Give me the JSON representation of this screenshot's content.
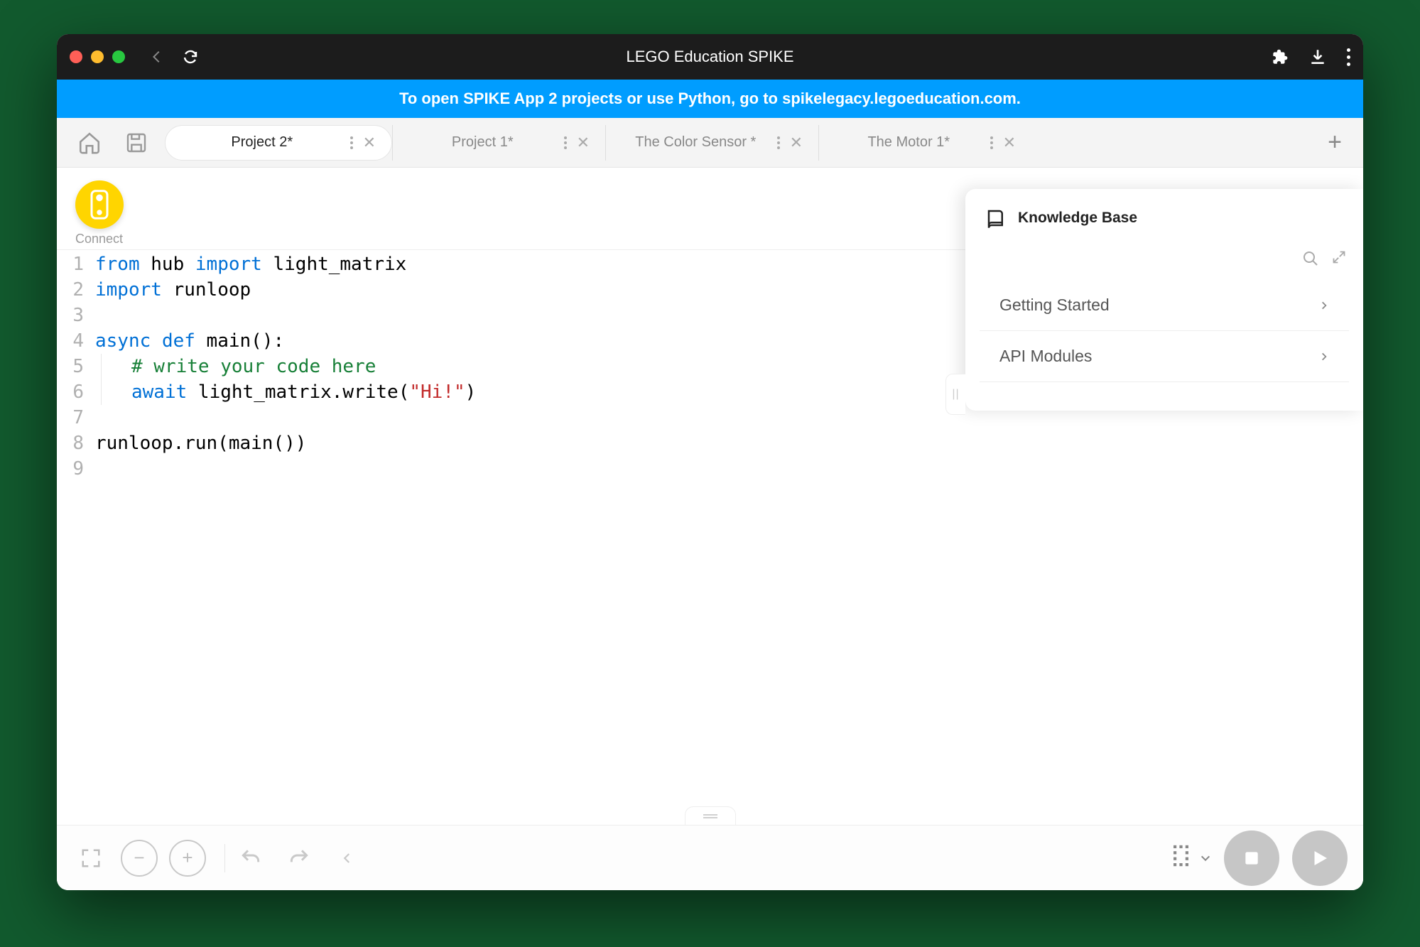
{
  "titlebar": {
    "title": "LEGO Education SPIKE"
  },
  "banner": {
    "text": "To open SPIKE App 2 projects or use Python, go to spikelegacy.legoeducation.com."
  },
  "tabs": [
    {
      "label": "Project 2*",
      "active": true
    },
    {
      "label": "Project 1*",
      "active": false
    },
    {
      "label": "The Color Sensor *",
      "active": false
    },
    {
      "label": "The Motor 1*",
      "active": false
    }
  ],
  "connect": {
    "label": "Connect"
  },
  "code": {
    "lines": [
      {
        "n": "1",
        "html": "<span class='kw'>from</span> hub <span class='kw'>import</span> light_matrix"
      },
      {
        "n": "2",
        "html": "<span class='kw'>import</span> runloop"
      },
      {
        "n": "3",
        "html": ""
      },
      {
        "n": "4",
        "html": "<span class='kw'>async</span> <span class='kw'>def</span> main()<span>:</span>"
      },
      {
        "n": "5",
        "html": "<span class='indent-guide'><span class='cm'># write your code here</span></span>"
      },
      {
        "n": "6",
        "html": "<span class='indent-guide'><span class='kw'>await</span> light_matrix.write(<span class='str'>\"Hi!\"</span>)</span>"
      },
      {
        "n": "7",
        "html": ""
      },
      {
        "n": "8",
        "html": "runloop.run(main())"
      },
      {
        "n": "9",
        "html": ""
      }
    ]
  },
  "kb": {
    "title": "Knowledge Base",
    "items": [
      {
        "label": "Getting Started"
      },
      {
        "label": "API Modules"
      }
    ]
  }
}
